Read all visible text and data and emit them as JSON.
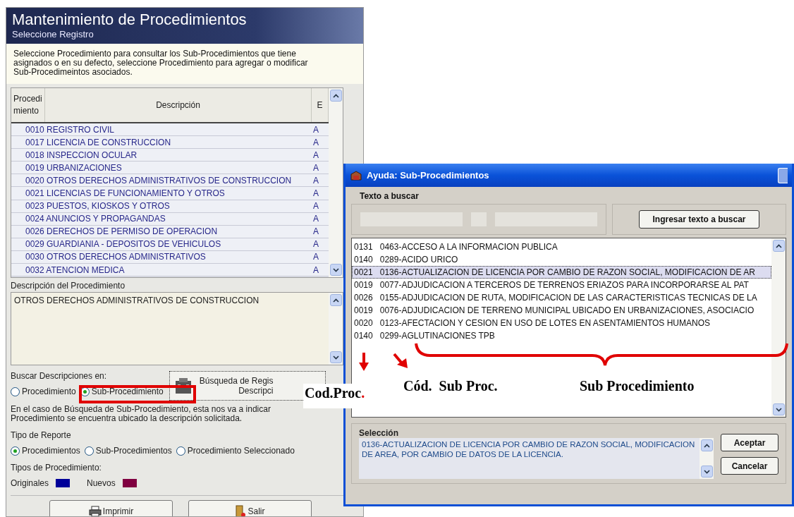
{
  "main_window": {
    "title": "Mantenimiento de Procedimientos",
    "subtitle": "Seleccione Registro",
    "intro": "Seleccione Procedimiento para consultar los Sub-Procedimientos que tiene asignados o en su defecto, seleccione Procedimiento para agregar o modificar Sub-Procedimeintos asociados.",
    "table": {
      "columns": [
        "Procedimiento",
        "Descripción",
        "E"
      ],
      "rows": [
        {
          "text": "0010 REGISTRO CIVIL",
          "e": "A"
        },
        {
          "text": "0017 LICENCIA DE CONSTRUCCION",
          "e": "A"
        },
        {
          "text": "0018 INSPECCION OCULAR",
          "e": "A"
        },
        {
          "text": "0019 URBANIZACIONES",
          "e": "A"
        },
        {
          "text": "0020 OTROS DERECHOS ADMINISTRATIVOS DE CONSTRUCCION",
          "e": "A"
        },
        {
          "text": "0021 LICENCIAS DE FUNCIONAMIENTO Y OTROS",
          "e": "A"
        },
        {
          "text": "0023 PUESTOS, KIOSKOS Y OTROS",
          "e": "A"
        },
        {
          "text": "0024 ANUNCIOS Y PROPAGANDAS",
          "e": "A"
        },
        {
          "text": "0026 DERECHOS DE PERMISO DE OPERACION",
          "e": "A"
        },
        {
          "text": "0029 GUARDIANIA - DEPOSITOS DE VEHICULOS",
          "e": "A"
        },
        {
          "text": "0030 OTROS DERECHOS ADMINISTRATIVOS",
          "e": "A"
        },
        {
          "text": "0032 ATENCION MEDICA",
          "e": "A"
        }
      ]
    },
    "description_label": "Descripción del Procedimiento",
    "description_value": "OTROS DERECHOS ADMINISTRATIVOS DE CONSTRUCCION",
    "search_in": {
      "label": "Buscar Descripciones en:",
      "options": [
        {
          "label": "Procedimiento",
          "selected": false
        },
        {
          "label": "Sub-Procedimiento",
          "selected": true
        }
      ]
    },
    "search_button": [
      "Búsqueda de Regis",
      "Descripci"
    ],
    "note_lines": [
      "En el caso de Búsqueda de Sub-Procedimiento, esta nos va a indicar",
      "Procedimiento se encuentra ubicado la descripción solicitada."
    ],
    "report_type": {
      "label": "Tipo de Reporte",
      "options": [
        {
          "label": "Procedimientos",
          "selected": true
        },
        {
          "label": "Sub-Procedimientos",
          "selected": false
        },
        {
          "label": "Procedimiento Seleccionado",
          "selected": false
        }
      ]
    },
    "procedure_types": {
      "label": "Tipos de Procedimiento:",
      "items": [
        {
          "label": "Originales",
          "color": "#000099"
        },
        {
          "label": "Nuevos",
          "color": "#800040"
        }
      ]
    },
    "buttons": [
      {
        "label": "Imprimir",
        "kind": "print"
      },
      {
        "label": "Salir",
        "kind": "exit"
      }
    ]
  },
  "dialog": {
    "title": "Ayuda: Sub-Procedimientos",
    "search_label": "Texto a buscar",
    "search_button": "Ingresar texto a buscar",
    "rows": [
      {
        "proc": "0131",
        "sub": "0463-ACCESO A LA INFORMACION PUBLICA",
        "selected": false
      },
      {
        "proc": "0140",
        "sub": "0289-ACIDO URICO",
        "selected": false
      },
      {
        "proc": "0021",
        "sub": "0136-ACTUALIZACION DE LICENCIA POR CAMBIO DE RAZON SOCIAL, MODIFICACION DE AR",
        "selected": true
      },
      {
        "proc": "0019",
        "sub": "0077-ADJUDICACION A TERCEROS DE TERRENOS ERIAZOS PARA INCORPORARSE AL PAT",
        "selected": false
      },
      {
        "proc": "0026",
        "sub": "0155-ADJUDICACION DE RUTA, MODIFICACION DE LAS CARACTERISTICAS TECNICAS DE LA",
        "selected": false
      },
      {
        "proc": "0019",
        "sub": "0076-ADJUDICACION DE TERRENO MUNICIPAL UBICADO EN URBANIZACIONES, ASOCIACIO",
        "selected": false
      },
      {
        "proc": "0020",
        "sub": "0123-AFECTACION Y CESION EN USO DE LOTES EN ASENTAMIENTOS HUMANOS",
        "selected": false
      },
      {
        "proc": "0140",
        "sub": "0299-AGLUTINACIONES TPB",
        "selected": false
      }
    ],
    "selection": {
      "label": "Selección",
      "value": "0136-ACTUALIZACION DE LICENCIA POR CAMBIO DE RAZON SOCIAL, MODIFICACION DE AREA, POR CAMBIO DE DATOS DE LA LICENCIA."
    },
    "buttons": [
      "Aceptar",
      "Cancelar"
    ]
  },
  "annotations": {
    "cod_proc": {
      "text": "Cod.Proc",
      "tail": "."
    },
    "cod_sub_proc": "Cód.  Sub Proc.",
    "sub_procedimiento": "Sub Procedimiento"
  }
}
